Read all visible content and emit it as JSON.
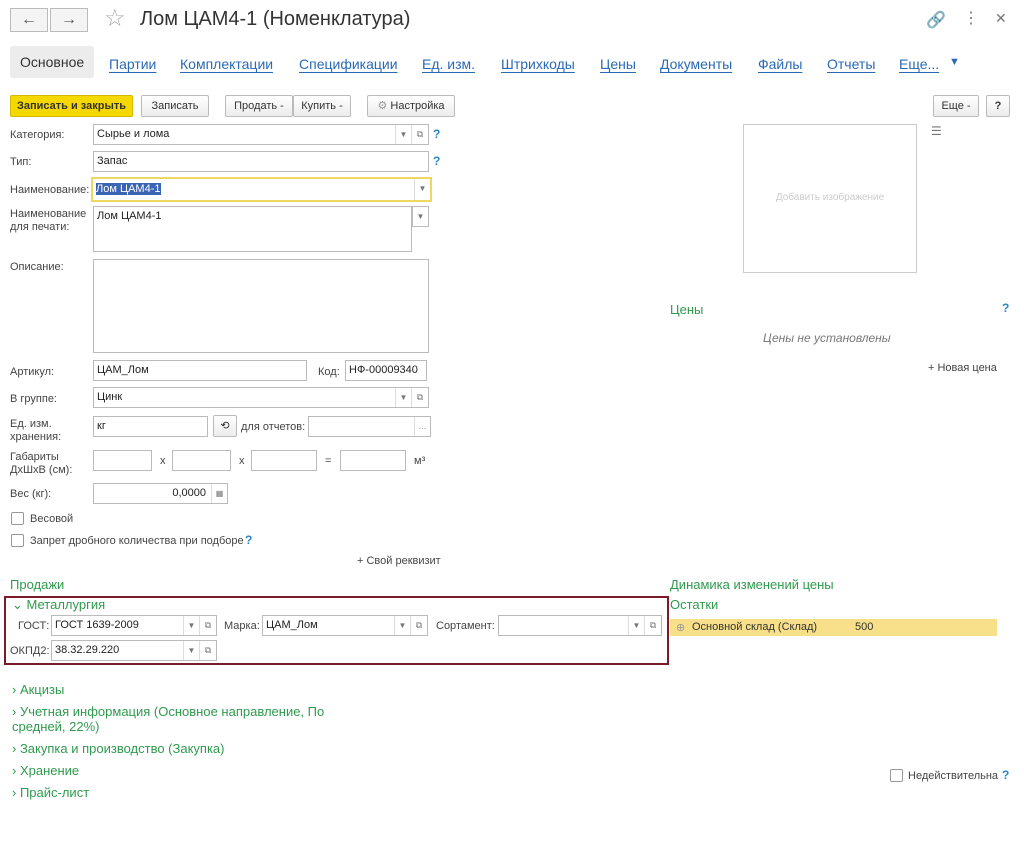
{
  "window": {
    "title": "Лом ЦАМ4-1 (Номенклатура)"
  },
  "tabs": [
    "Основное",
    "Партии",
    "Комплектации",
    "Спецификации",
    "Ед. изм.",
    "Штрихкоды",
    "Цены",
    "Документы",
    "Файлы",
    "Отчеты",
    "Еще..."
  ],
  "toolbar": {
    "save_close": "Записать и закрыть",
    "save": "Записать",
    "sell": "Продать",
    "buy": "Купить",
    "settings": "Настройка",
    "more": "Еще",
    "help": "?"
  },
  "form": {
    "category_label": "Категория:",
    "category": "Сырье и лома",
    "type_label": "Тип:",
    "type": "Запас",
    "name_label": "Наименование:",
    "name": "Лом ЦАМ4-1",
    "print_name_label": "Наименование для печати:",
    "print_name": "Лом ЦАМ4-1",
    "description_label": "Описание:",
    "article_label": "Артикул:",
    "article": "ЦАМ_Лом",
    "code_label": "Код:",
    "code": "НФ-00009340",
    "group_label": "В группе:",
    "group": "Цинк",
    "unit_label": "Ед. изм. хранения:",
    "unit": "кг",
    "reports_label": "для отчетов:",
    "dims_label": "Габариты ДхШхВ (см):",
    "x": "x",
    "eq": "=",
    "m3": "м³",
    "weight_label": "Вес (кг):",
    "weight": "0,0000",
    "weighted": "Весовой",
    "fraction_ban": "Запрет дробного количества при подборе",
    "custom_attr": "+ Свой реквизит"
  },
  "image": {
    "add": "Добавить изображение"
  },
  "prices": {
    "title": "Цены",
    "empty": "Цены не установлены",
    "new": "+ Новая цена"
  },
  "sections": {
    "sales": "Продажи",
    "metallurgy": "Металлургия",
    "price_dynamics": "Динамика изменений цены",
    "stock": "Остатки",
    "excise": "Акцизы",
    "accounting": "Учетная информация (Основное направление, По средней, 22%)",
    "purchase": "Закупка и производство (Закупка)",
    "storage": "Хранение",
    "pricelist": "Прайс-лист"
  },
  "metallurgy": {
    "gost_label": "ГОСТ:",
    "gost": "ГОСТ 1639-2009",
    "brand_label": "Марка:",
    "brand": "ЦАМ_Лом",
    "assortment_label": "Сортамент:",
    "okpd_label": "ОКПД2:",
    "okpd": "38.32.29.220"
  },
  "stock": {
    "warehouse": "Основной склад (Склад)",
    "qty": "500"
  },
  "invalid": "Недействительна"
}
